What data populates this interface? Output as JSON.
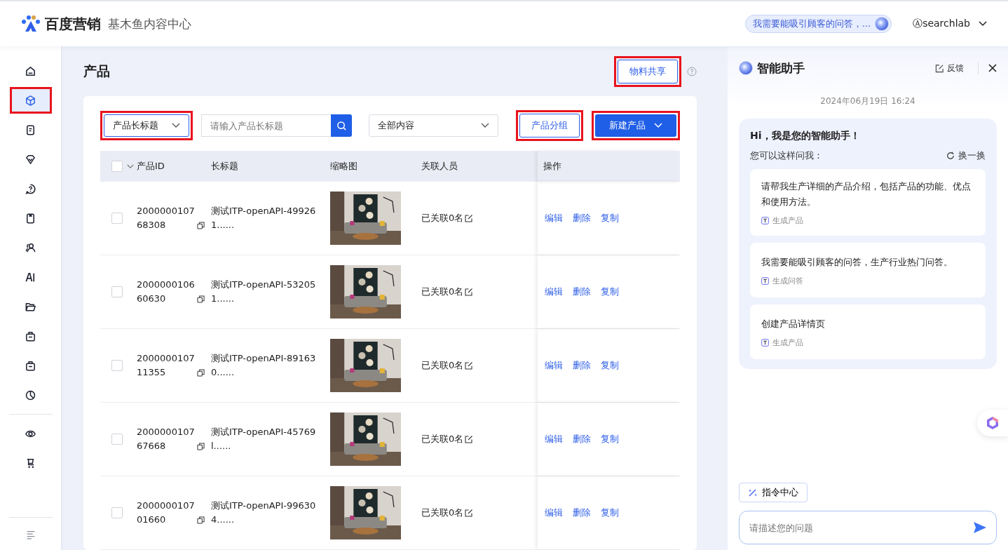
{
  "header": {
    "brand": "百度营销",
    "subtitle": "基木鱼内容中心",
    "prompt_chip": "我需要能吸引顾客的问答，...",
    "user": "Ⓐsearchlab"
  },
  "sidebar": {
    "items": [
      {
        "kind": "home",
        "selected": false,
        "highlighted": false
      },
      {
        "kind": "cube",
        "selected": true,
        "highlighted": true
      },
      {
        "kind": "document",
        "selected": false,
        "highlighted": false
      },
      {
        "kind": "diamond",
        "selected": false,
        "highlighted": false
      },
      {
        "kind": "question",
        "selected": false,
        "highlighted": false
      },
      {
        "kind": "bookmark",
        "selected": false,
        "highlighted": false
      },
      {
        "kind": "people",
        "selected": false,
        "highlighted": false
      },
      {
        "kind": "ai",
        "selected": false,
        "highlighted": false
      },
      {
        "kind": "folder",
        "selected": false,
        "highlighted": false
      },
      {
        "kind": "briefcase",
        "selected": false,
        "highlighted": false
      },
      {
        "kind": "briefcase",
        "selected": false,
        "highlighted": false
      },
      {
        "kind": "pie",
        "selected": false,
        "highlighted": false
      }
    ],
    "tools": [
      {
        "kind": "eye",
        "selected": false,
        "highlighted": false
      },
      {
        "kind": "cart",
        "selected": false,
        "highlighted": false
      }
    ]
  },
  "page": {
    "title": "产品",
    "share_button": {
      "label": "物料共享",
      "highlighted": true
    }
  },
  "toolbar": {
    "field_select": {
      "label": "产品长标题",
      "highlighted": true
    },
    "search": {
      "placeholder": "请输入产品长标题"
    },
    "content_select": {
      "label": "全部内容"
    },
    "group_button": {
      "label": "产品分组",
      "highlighted": true
    },
    "new_button": {
      "label": "新建产品",
      "highlighted": true
    }
  },
  "table": {
    "all_checked": false,
    "columns": [
      "产品ID",
      "长标题",
      "缩略图",
      "关联人员",
      "操作"
    ],
    "rows": [
      {
        "id": "200000010768308",
        "title": "测试ITP-openAPI-499261......",
        "people": "已关联0名",
        "actions": [
          "编辑",
          "删除",
          "复制"
        ],
        "checked": false
      },
      {
        "id": "200000010660630",
        "title": "测试ITP-openAPI-532051......",
        "people": "已关联0名",
        "actions": [
          "编辑",
          "删除",
          "复制"
        ],
        "checked": false
      },
      {
        "id": "200000010711355",
        "title": "测试ITP-openAPI-891630......",
        "people": "已关联0名",
        "actions": [
          "编辑",
          "删除",
          "复制"
        ],
        "checked": false
      },
      {
        "id": "200000010767668",
        "title": "测试ITP-openAPI-45769l......",
        "people": "已关联0名",
        "actions": [
          "编辑",
          "删除",
          "复制"
        ],
        "checked": false
      },
      {
        "id": "200000010701660",
        "title": "测试ITP-openAPI-996304......",
        "people": "已关联0名",
        "actions": [
          "编辑",
          "删除",
          "复制"
        ],
        "checked": false
      }
    ]
  },
  "assistant": {
    "title": "智能助手",
    "feedback": "反馈",
    "timestamp": "2024年06月19日 16:24",
    "greeting": "Hi，我是您的智能助手！",
    "hint": "您可以这样问我：",
    "refresh": "换一换",
    "suggestions": [
      {
        "text": "请帮我生产详细的产品介绍，包括产品的功能、优点和使用方法。",
        "tag": "生成产品"
      },
      {
        "text": "我需要能吸引顾客的问答，生产行业热门问答。",
        "tag": "生成问答"
      },
      {
        "text": "创建产品详情页",
        "tag": "生成产品"
      }
    ],
    "command_button": "指令中心",
    "input": {
      "placeholder": "请描述您的问题"
    }
  }
}
